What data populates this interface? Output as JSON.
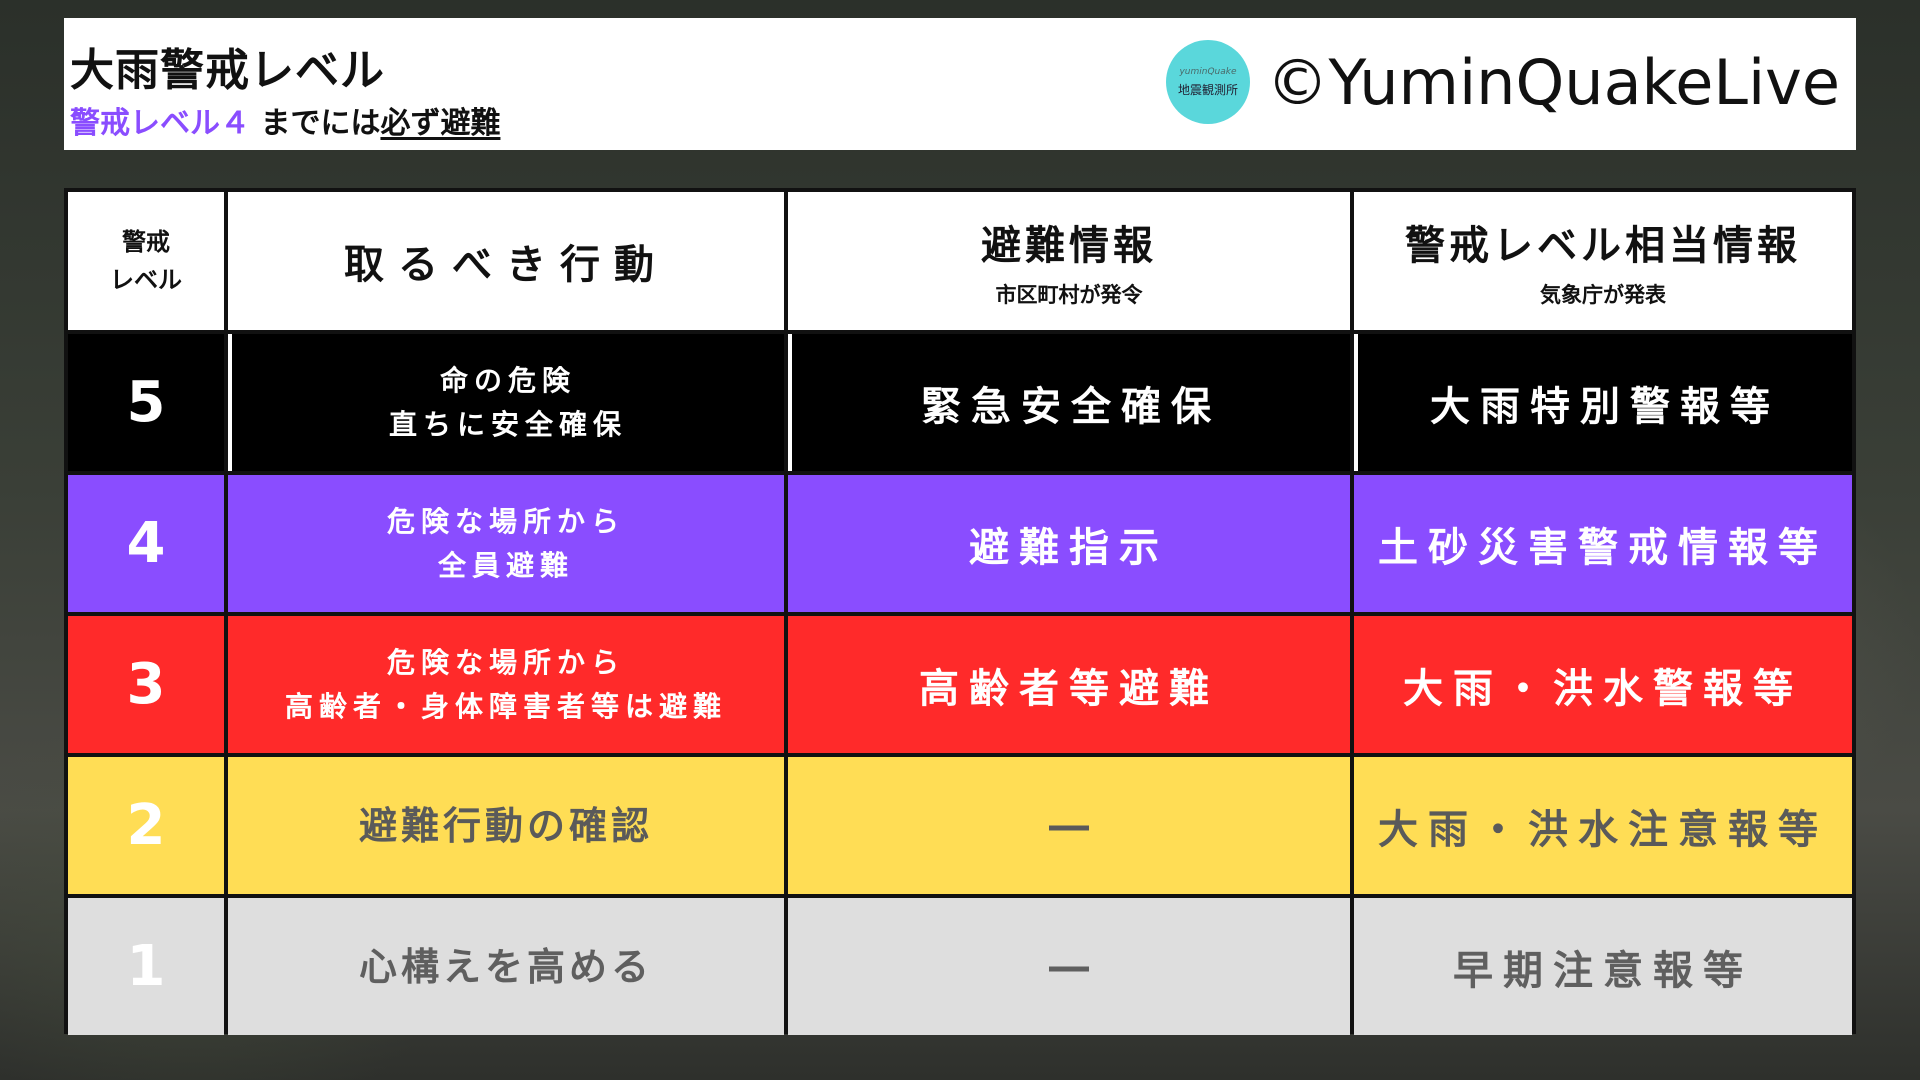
{
  "header": {
    "title": "大雨警戒レベル",
    "subtitle_accent": "警戒レベル４",
    "subtitle_mid": "までには",
    "subtitle_must": "必ず避難",
    "logo_top": "yuminQuake",
    "logo_main": "地震観測所",
    "copyright": "©YuminQuakeLive"
  },
  "table": {
    "headers": {
      "level_line1": "警戒",
      "level_line2": "レベル",
      "action": "取るべき行動",
      "evac": "避難情報",
      "evac_sub": "市区町村が発令",
      "equiv": "警戒レベル相当情報",
      "equiv_sub": "気象庁が発表"
    },
    "rows": [
      {
        "level": "5",
        "action_line1": "命の危険",
        "action_line2": "直ちに安全確保",
        "evac": "緊急安全確保",
        "equiv": "大雨特別警報等"
      },
      {
        "level": "4",
        "action_line1": "危険な場所から",
        "action_line2": "全員避難",
        "evac": "避難指示",
        "equiv": "土砂災害警戒情報等"
      },
      {
        "level": "3",
        "action_line1": "危険な場所から",
        "action_line2": "高齢者・身体障害者等は避難",
        "evac": "高齢者等避難",
        "equiv": "大雨・洪水警報等"
      },
      {
        "level": "2",
        "action": "避難行動の確認",
        "evac": "―",
        "equiv": "大雨・洪水注意報等"
      },
      {
        "level": "1",
        "action": "心構えを高める",
        "evac": "―",
        "equiv": "早期注意報等"
      }
    ],
    "colors": {
      "level5": "#000000",
      "level4": "#8a4dff",
      "level3": "#ff2a2a",
      "level2": "#ffdd55",
      "level1": "#dedede"
    }
  }
}
